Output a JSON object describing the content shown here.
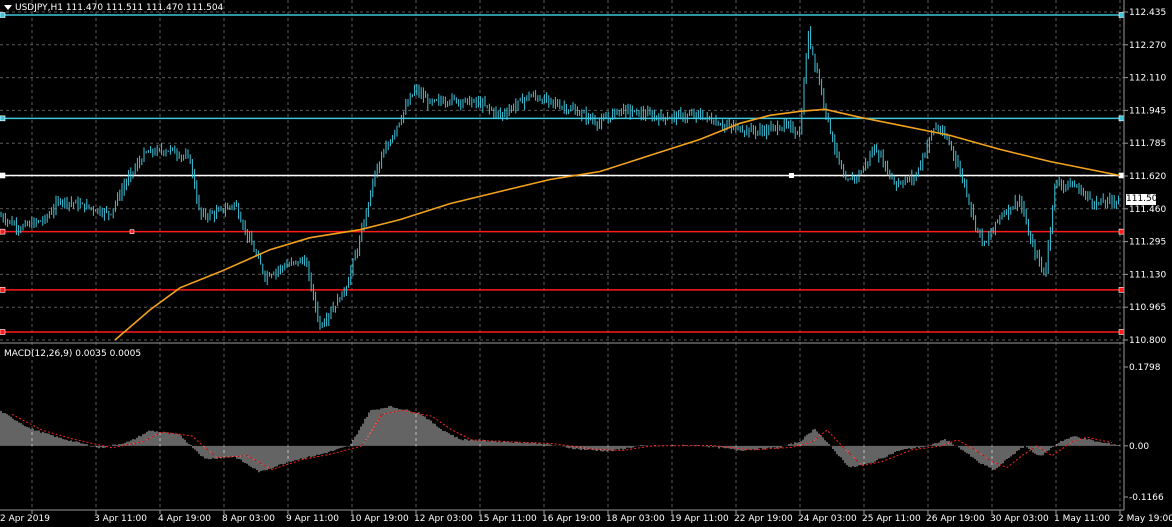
{
  "header": {
    "symbol_line": "USDJPY,H1  111.470 111.511 111.470 111.504",
    "indicator_line": "MACD(12,26,9) 0.0035 0.0005"
  },
  "current_price_label": "111.504",
  "price_axis_labels": [
    "112.435",
    "112.270",
    "112.110",
    "111.945",
    "111.785",
    "111.620",
    "111.460",
    "111.295",
    "111.130",
    "110.965",
    "110.800"
  ],
  "macd_axis_labels": [
    "0.1798",
    "0.00",
    "-0.1166"
  ],
  "time_axis_labels": [
    "2 Apr 2019",
    "3 Apr 11:00",
    "4 Apr 19:00",
    "8 Apr 03:00",
    "9 Apr 11:00",
    "10 Apr 19:00",
    "12 Apr 03:00",
    "15 Apr 11:00",
    "16 Apr 19:00",
    "18 Apr 03:00",
    "19 Apr 11:00",
    "22 Apr 19:00",
    "24 Apr 03:00",
    "25 Apr 11:00",
    "26 Apr 19:00",
    "30 Apr 03:00",
    "1 May 11:00",
    "2 May 19:00"
  ],
  "horizontal_levels": [
    {
      "price": 112.42,
      "color": "#3fc6dc"
    },
    {
      "price": 111.905,
      "color": "#3fc6dc"
    },
    {
      "price": 111.62,
      "color": "#ffffff"
    },
    {
      "price": 111.34,
      "color": "#ff1a1a"
    },
    {
      "price": 111.05,
      "color": "#ff1a1a"
    },
    {
      "price": 110.84,
      "color": "#ff1a1a"
    }
  ],
  "colors": {
    "background": "#000000",
    "grid": "#5a5a5a",
    "candles": "#3fc6dc",
    "moving_average": "#f2a21c",
    "macd_histogram": "#c8c8c8",
    "macd_signal": "#ff2020"
  }
}
